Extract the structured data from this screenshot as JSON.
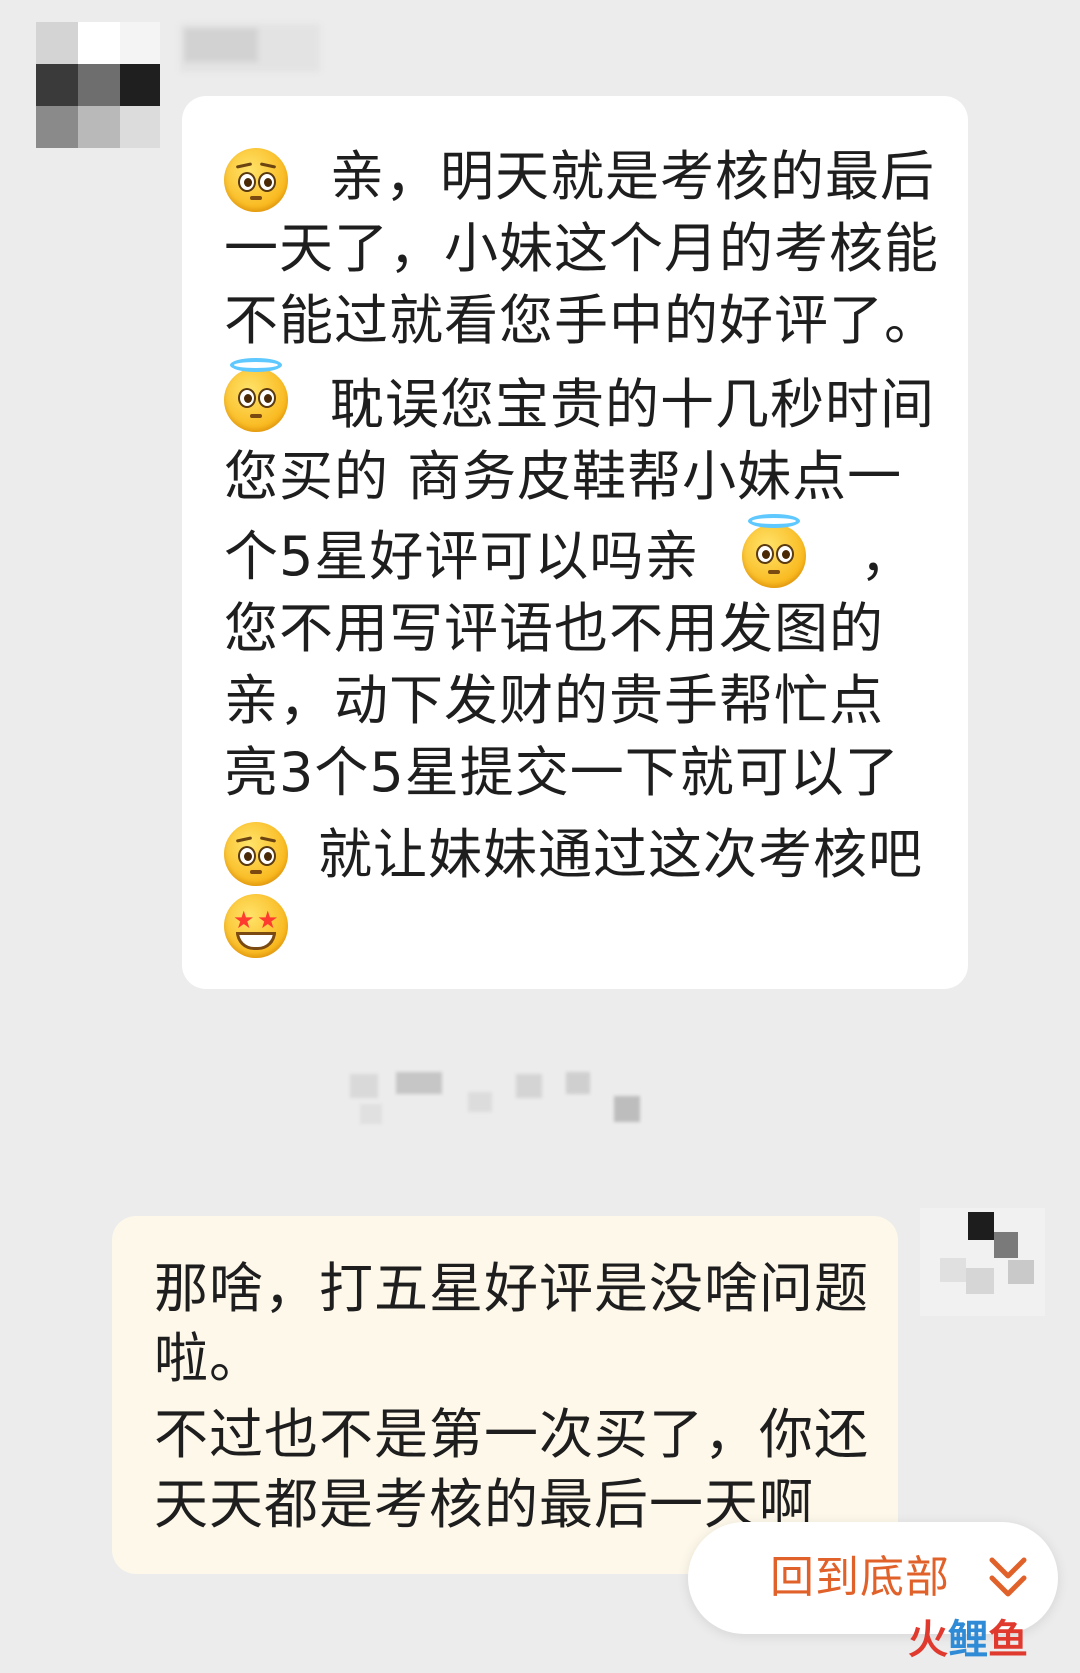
{
  "colors": {
    "page_background": "#ececec",
    "incoming_bubble": "#ffffff",
    "outgoing_bubble": "#fdf8ea",
    "back_to_bottom_accent": "#e0612a",
    "message_text": "#1e1e1e"
  },
  "incoming_message": {
    "sender_avatar": "pixelated-avatar",
    "lines": {
      "l1": "亲，明天就是考核的最后",
      "l2": "一天了，小妹这个月的考核能",
      "l3": "不能过就看您手中的好评了。",
      "l4": "耽误您宝贵的十几秒时间",
      "l5": "您买的  商务皮鞋帮小妹点一",
      "l6a": "个5星好评可以吗亲",
      "l6b": "，",
      "l7": "您不用写评语也不用发图的",
      "l8": "亲，动下发财的贵手帮忙点",
      "l9": "亮3个5星提交一下就可以了",
      "l10": "就让妹妹通过这次考核吧"
    },
    "emojis": [
      "pleading-face-emoji",
      "smiling-face-with-halo-emoji",
      "smiling-face-with-halo-emoji",
      "pleading-face-emoji",
      "star-struck-emoji"
    ]
  },
  "outgoing_message": {
    "lines": {
      "l1": "那啥，打五星好评是没啥问题",
      "l2": "啦。",
      "l3": "不过也不是第一次买了，你还",
      "l4": "天天都是考核的最后一天啊"
    }
  },
  "back_to_bottom": {
    "label": "回到底部",
    "icon": "double-chevron-down-icon"
  },
  "watermark": {
    "part1": "火",
    "part2": "鲤",
    "part3": "鱼"
  }
}
